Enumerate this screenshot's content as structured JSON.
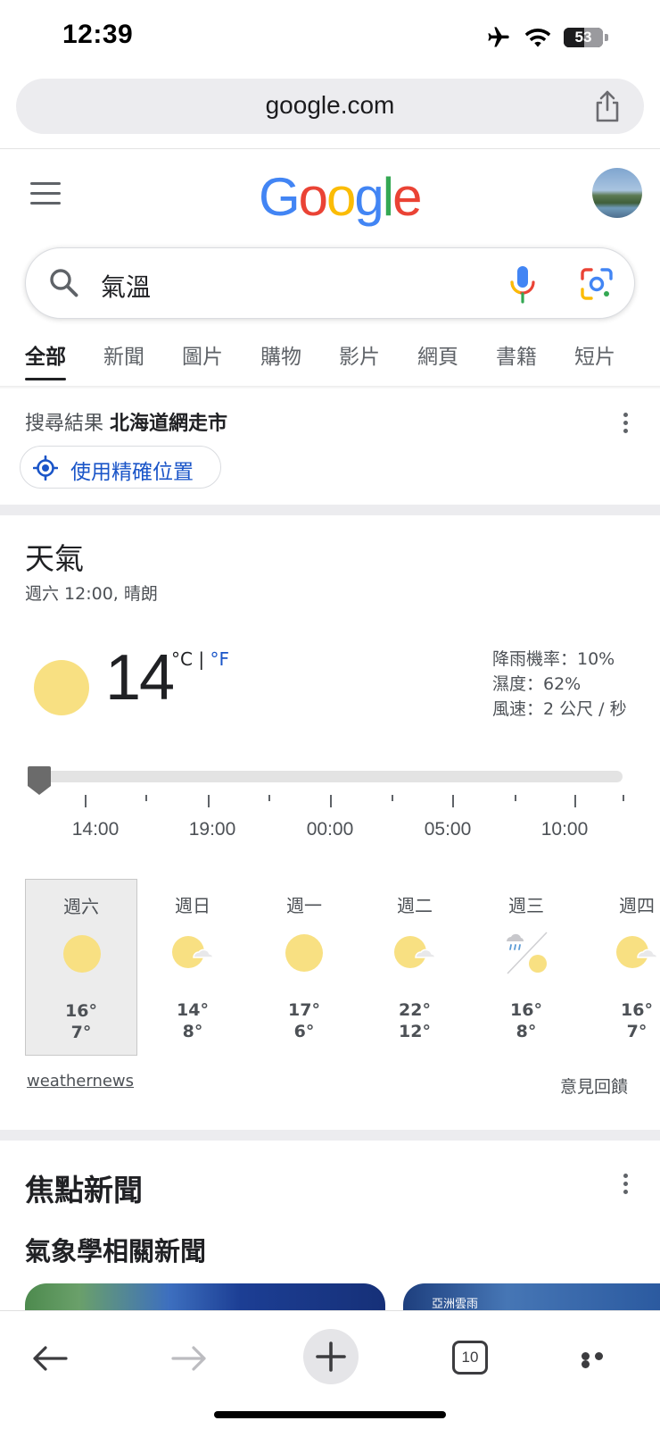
{
  "status_bar": {
    "time": "12:39",
    "battery": "53",
    "battery_level_percent": 53,
    "icons": [
      "airplane-icon",
      "wifi-icon",
      "battery-icon"
    ]
  },
  "browser": {
    "url": "google.com",
    "tab_count": "10",
    "toolbar_icons": [
      "back-arrow-icon",
      "forward-arrow-icon",
      "plus-icon",
      "tabs-icon",
      "more-icon"
    ]
  },
  "google": {
    "logo_letters": [
      "G",
      "o",
      "o",
      "g",
      "l",
      "e"
    ],
    "logo_colors": [
      "#4285F4",
      "#EA4335",
      "#FBBC05",
      "#4285F4",
      "#34A853",
      "#EA4335"
    ]
  },
  "search": {
    "query": "氣溫"
  },
  "tabs": [
    "全部",
    "新聞",
    "圖片",
    "購物",
    "影片",
    "網頁",
    "書籍",
    "短片"
  ],
  "location": {
    "prefix": "搜尋結果",
    "place": "北海道網走市",
    "precise_button": "使用精確位置"
  },
  "weather": {
    "title": "天氣",
    "subtitle": "週六 12:00, 晴朗",
    "temperature": "14",
    "unit_c": "°C",
    "unit_sep": "|",
    "unit_f": "°F",
    "precipitation": "降雨機率：10%",
    "humidity": "濕度：62%",
    "wind": "風速：2 公尺 / 秒",
    "timeline_labels": [
      "14:00",
      "19:00",
      "00:00",
      "05:00",
      "10:00"
    ],
    "days": [
      {
        "label": "週六",
        "icon": "sun",
        "high": "16°",
        "low": "7°",
        "selected": true
      },
      {
        "label": "週日",
        "icon": "sun-cloud",
        "high": "14°",
        "low": "8°"
      },
      {
        "label": "週一",
        "icon": "sun",
        "high": "17°",
        "low": "6°"
      },
      {
        "label": "週二",
        "icon": "sun-cloud",
        "high": "22°",
        "low": "12°"
      },
      {
        "label": "週三",
        "icon": "rain-sun",
        "high": "16°",
        "low": "8°"
      },
      {
        "label": "週四",
        "icon": "sun-cloud",
        "high": "16°",
        "low": "7°"
      }
    ],
    "source": "weathernews",
    "feedback": "意見回饋",
    "sun_color": "#F8E082"
  },
  "news": {
    "title": "焦點新聞",
    "subtitle": "氣象學相關新聞",
    "card2_caption": "亞洲雲雨"
  },
  "colors": {
    "link_blue": "#1A55C8",
    "text_primary": "#202124",
    "text_secondary": "#4D5156"
  }
}
